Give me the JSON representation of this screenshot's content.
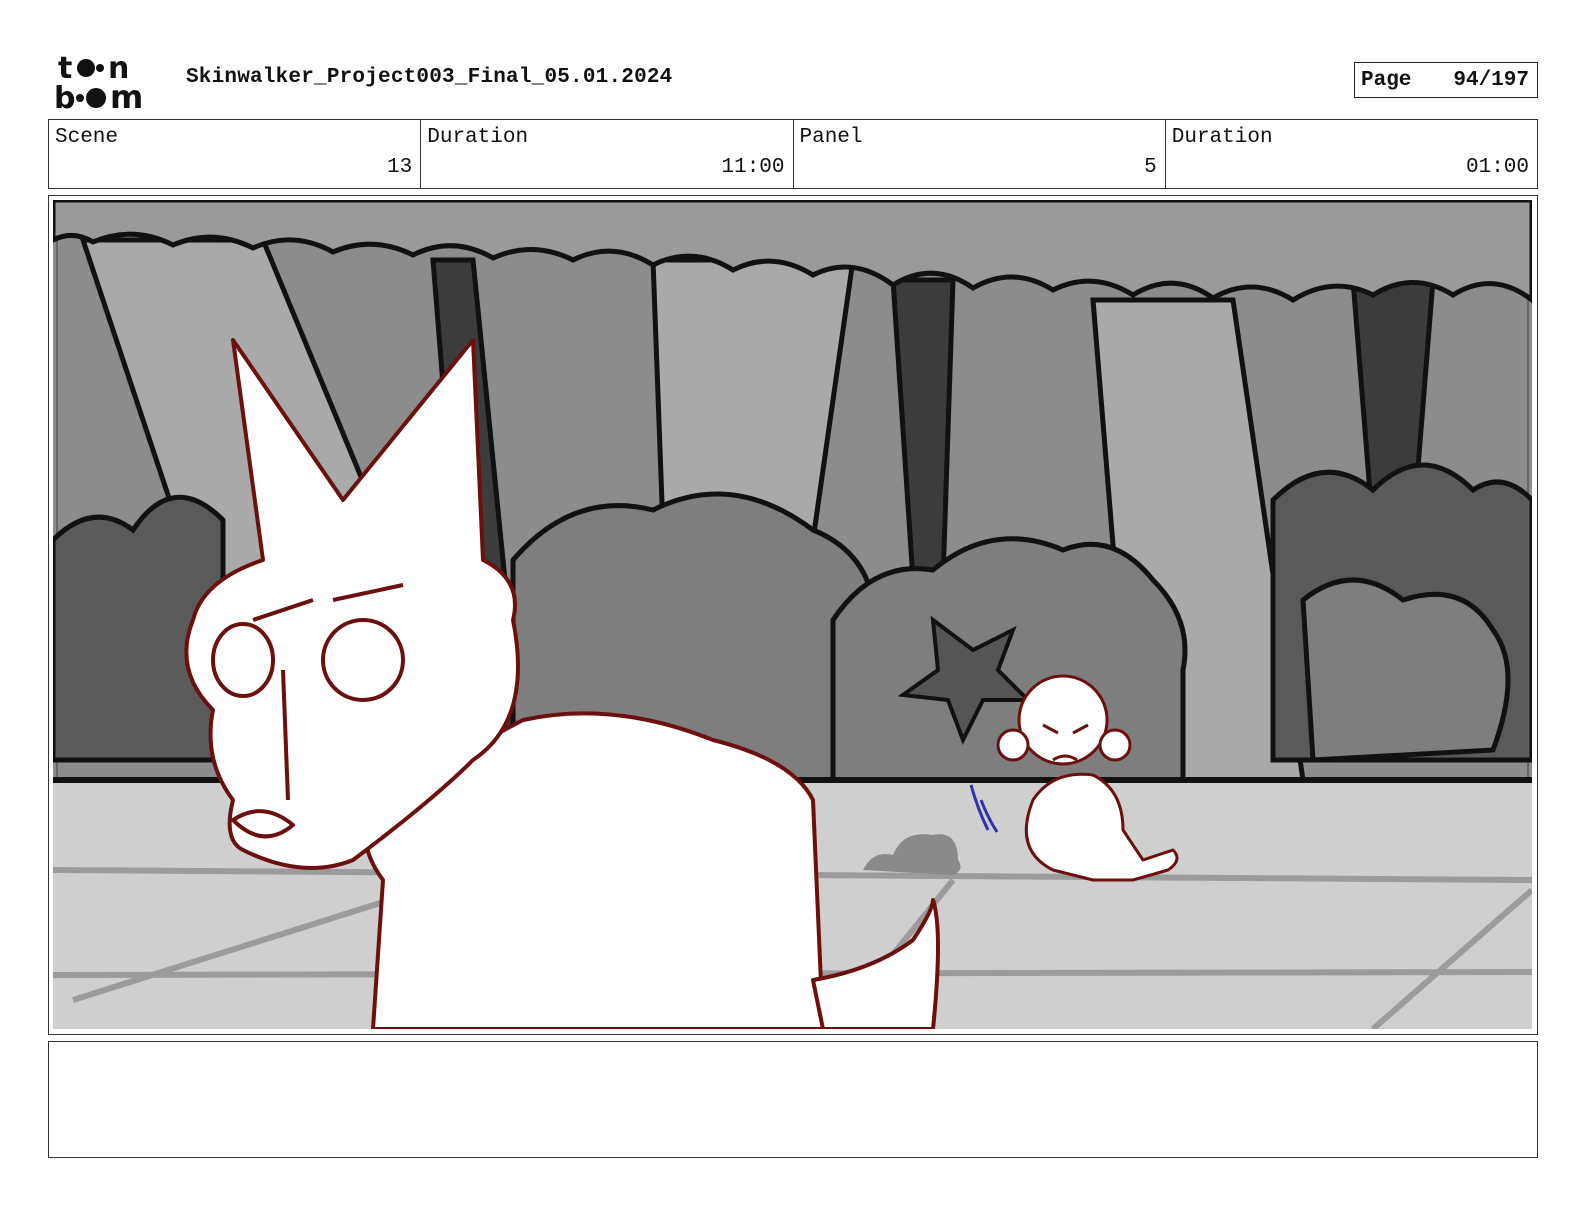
{
  "header": {
    "logo_text": "toon boom",
    "project_title": "Skinwalker_Project003_Final_05.01.2024",
    "page_label": "Page",
    "page_number": "94/197"
  },
  "info": {
    "scene_label": "Scene",
    "scene_value": "13",
    "scene_duration_label": "Duration",
    "scene_duration_value": "11:00",
    "panel_label": "Panel",
    "panel_value": "5",
    "panel_duration_label": "Duration",
    "panel_duration_value": "01:00"
  },
  "notes": {
    "text": ""
  },
  "colors": {
    "sketch_line": "#6b0f0f",
    "action_line": "#2f2fb0",
    "ink": "#111111"
  }
}
